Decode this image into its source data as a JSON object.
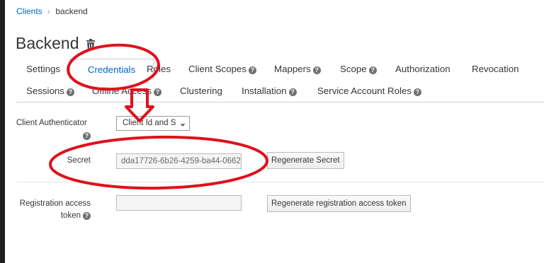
{
  "breadcrumb": {
    "parent": "Clients",
    "current": "backend"
  },
  "page": {
    "title": "Backend",
    "delete_icon": "trash-icon"
  },
  "tabs": {
    "settings": "Settings",
    "credentials": "Credentials",
    "roles": "Roles",
    "client_scopes": "Client Scopes",
    "mappers": "Mappers",
    "scope": "Scope",
    "authorization": "Authorization",
    "revocation": "Revocation",
    "sessions": "Sessions",
    "offline_access": "Offline Access",
    "clustering": "Clustering",
    "installation": "Installation",
    "service_account_roles": "Service Account Roles",
    "help_icon": "?"
  },
  "form": {
    "client_authenticator_label": "Client Authenticator",
    "client_authenticator_value": "Client Id and S",
    "secret_label": "Secret",
    "secret_value": "dda17726-6b26-4259-ba44-0662",
    "regenerate_secret_label": "Regenerate Secret",
    "registration_label_line1": "Registration access",
    "registration_label_line2": "token",
    "registration_value": "",
    "regenerate_token_label": "Regenerate registration access token"
  },
  "annotation": {
    "color": "#e0101b"
  },
  "colors": {
    "link": "#0066cc",
    "text": "#363636",
    "rail": "#1f1f1f"
  }
}
